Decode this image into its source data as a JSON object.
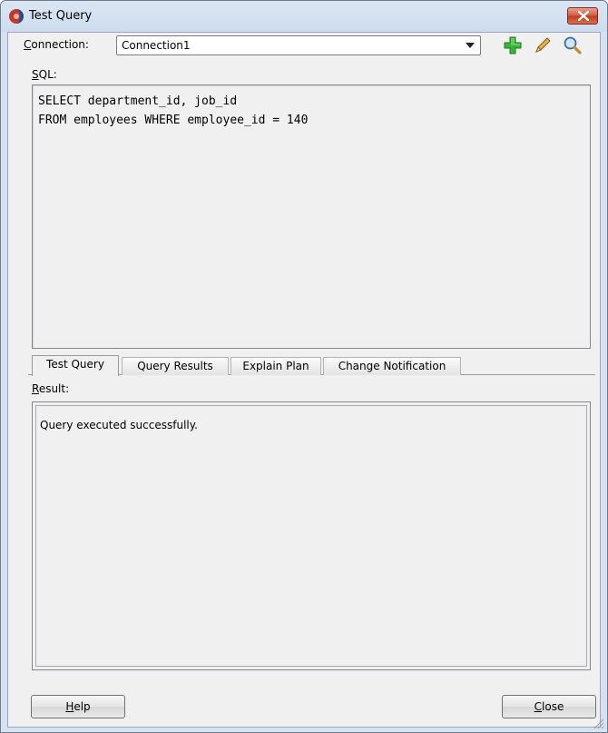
{
  "window": {
    "title": "Test Query"
  },
  "connection": {
    "label_mnemonic": "C",
    "label_rest": "onnection:",
    "selected": "Connection1"
  },
  "toolbar": {
    "icons": [
      "add-icon",
      "edit-pencil-icon",
      "browse-magnifier-icon"
    ]
  },
  "sql": {
    "label_mnemonic": "S",
    "label_rest": "QL:",
    "lines": [
      "SELECT department_id, job_id",
      "FROM employees WHERE employee_id = 140"
    ]
  },
  "tabs": [
    {
      "label": "Test Query",
      "active": true
    },
    {
      "label": "Query Results",
      "active": false
    },
    {
      "label": "Explain Plan",
      "active": false
    },
    {
      "label": "Change Notification",
      "active": false
    }
  ],
  "result": {
    "label_mnemonic": "R",
    "label_rest": "esult:",
    "text": "Query executed successfully."
  },
  "buttons": {
    "help_mnemonic": "H",
    "help_rest": "elp",
    "close_mnemonic": "C",
    "close_rest": "lose"
  },
  "colors": {
    "add_icon": "#2fa52f",
    "pencil": "#c98a28",
    "close_button": "#c8452a"
  }
}
